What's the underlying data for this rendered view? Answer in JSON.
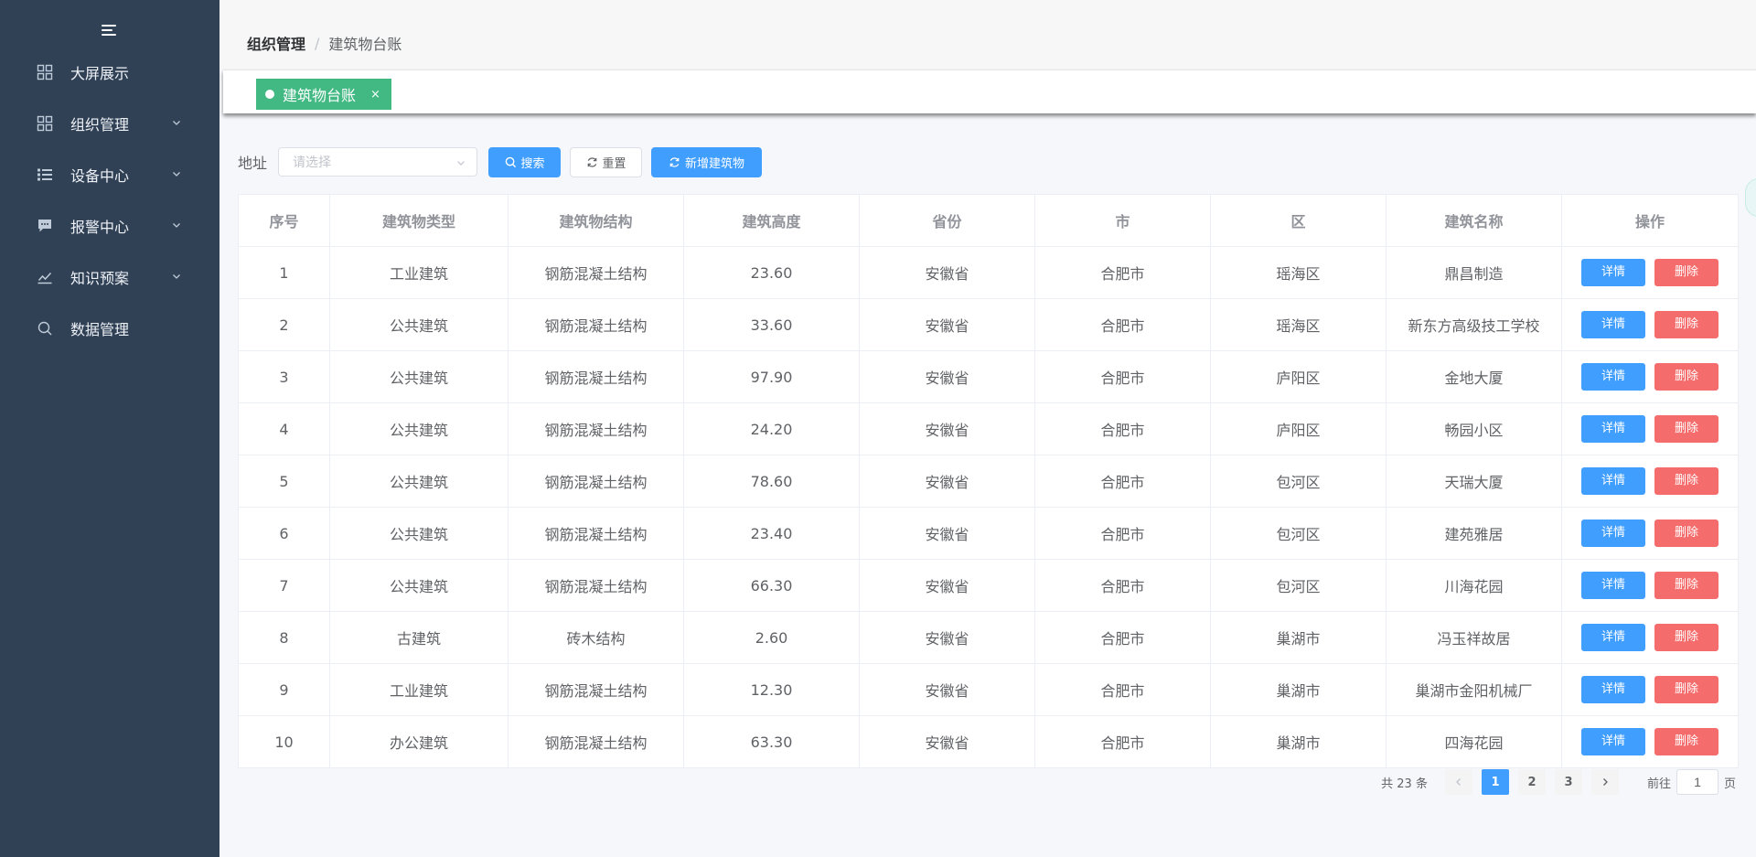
{
  "sidebar": {
    "items": [
      {
        "label": "大屏展示",
        "icon": "dashboard-icon",
        "expandable": false
      },
      {
        "label": "组织管理",
        "icon": "dashboard-icon",
        "expandable": true
      },
      {
        "label": "设备中心",
        "icon": "list-icon",
        "expandable": true
      },
      {
        "label": "报警中心",
        "icon": "message-icon",
        "expandable": true
      },
      {
        "label": "知识预案",
        "icon": "chart-icon",
        "expandable": true
      },
      {
        "label": "数据管理",
        "icon": "search-icon",
        "expandable": false
      }
    ]
  },
  "breadcrumb": {
    "parent": "组织管理",
    "separator": "/",
    "current": "建筑物台账"
  },
  "tags": {
    "active": "建筑物台账",
    "close": "×",
    "active_color": "#42b983"
  },
  "search": {
    "address_label": "地址",
    "address_placeholder": "请选择",
    "search_label": "搜索",
    "reset_label": "重置",
    "add_label": "新增建筑物"
  },
  "table": {
    "headers": [
      "序号",
      "建筑物类型",
      "建筑物结构",
      "建筑高度",
      "省份",
      "市",
      "区",
      "建筑名称",
      "操作"
    ],
    "detail_label": "详情",
    "delete_label": "删除",
    "rows": [
      [
        "1",
        "工业建筑",
        "钢筋混凝土结构",
        "23.60",
        "安徽省",
        "合肥市",
        "瑶海区",
        "鼎昌制造"
      ],
      [
        "2",
        "公共建筑",
        "钢筋混凝土结构",
        "33.60",
        "安徽省",
        "合肥市",
        "瑶海区",
        "新东方高级技工学校"
      ],
      [
        "3",
        "公共建筑",
        "钢筋混凝土结构",
        "97.90",
        "安徽省",
        "合肥市",
        "庐阳区",
        "金地大厦"
      ],
      [
        "4",
        "公共建筑",
        "钢筋混凝土结构",
        "24.20",
        "安徽省",
        "合肥市",
        "庐阳区",
        "畅园小区"
      ],
      [
        "5",
        "公共建筑",
        "钢筋混凝土结构",
        "78.60",
        "安徽省",
        "合肥市",
        "包河区",
        "天瑞大厦"
      ],
      [
        "6",
        "公共建筑",
        "钢筋混凝土结构",
        "23.40",
        "安徽省",
        "合肥市",
        "包河区",
        "建苑雅居"
      ],
      [
        "7",
        "公共建筑",
        "钢筋混凝土结构",
        "66.30",
        "安徽省",
        "合肥市",
        "包河区",
        "川海花园"
      ],
      [
        "8",
        "古建筑",
        "砖木结构",
        "2.60",
        "安徽省",
        "合肥市",
        "巢湖市",
        "冯玉祥故居"
      ],
      [
        "9",
        "工业建筑",
        "钢筋混凝土结构",
        "12.30",
        "安徽省",
        "合肥市",
        "巢湖市",
        "巢湖市金阳机械厂"
      ],
      [
        "10",
        "办公建筑",
        "钢筋混凝土结构",
        "63.30",
        "安徽省",
        "合肥市",
        "巢湖市",
        "四海花园"
      ]
    ]
  },
  "pagination": {
    "total_text": "共 23 条",
    "pages": [
      "1",
      "2",
      "3"
    ],
    "current_page": "1",
    "goto_label": "前往",
    "goto_value": "1",
    "page_unit": "页"
  },
  "colors": {
    "sidebar_bg": "#304156",
    "primary": "#409eff",
    "danger": "#f56c6c",
    "tag": "#42b983"
  }
}
